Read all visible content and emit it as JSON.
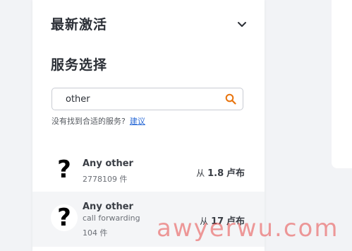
{
  "recent": {
    "title": "最新激活",
    "toggle_icon": "chevron-down-icon"
  },
  "services": {
    "title": "服务选择",
    "search": {
      "value": "other",
      "icon": "search-icon",
      "accent": "#e8740e"
    },
    "not_found_text": "没有找到合适的服务?",
    "suggest_link": "建议",
    "items": [
      {
        "logo": "?",
        "name": "Any other",
        "subtitle": "",
        "count": "2778109 件",
        "price_prefix": "从",
        "price_value": "1.8",
        "price_unit": "卢布"
      },
      {
        "logo": "?",
        "name": "Any other",
        "subtitle": "call forwarding",
        "count": "104 件",
        "price_prefix": "从",
        "price_value": "17",
        "price_unit": "卢布"
      }
    ]
  },
  "watermark": {
    "text": "awyerwu.com"
  }
}
